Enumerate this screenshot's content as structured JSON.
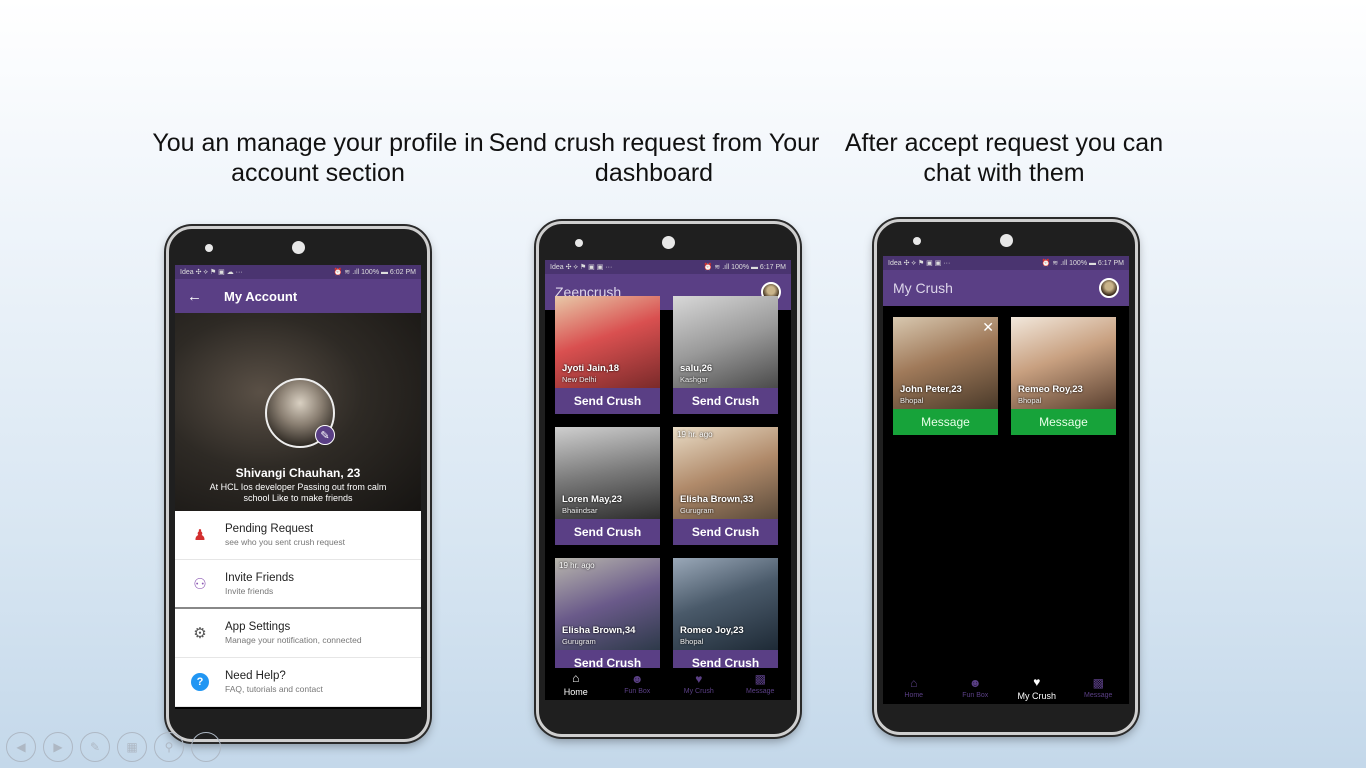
{
  "captions": {
    "left": "You an manage your profile in account section",
    "middle": "Send crush request from Your dashboard",
    "right": "After accept request you can chat with them"
  },
  "phone1": {
    "status_left": "Idea ✣ ⟡ ⚑ ▣ ☁ ···",
    "status_right": "⏰ ≋ .ıll 100% ▬ 6:02 PM",
    "back_icon": "arrow-left-icon",
    "title": "My Account",
    "profile_name": "Shivangi Chauhan, 23",
    "profile_bio": "At HCL Ios developer Passing out from calm school Like to make friends",
    "menu": [
      {
        "title": "Pending Request",
        "subtitle": "see who you sent crush request",
        "icon": "users-icon",
        "color": "#d32f2f"
      },
      {
        "title": "Invite Friends",
        "subtitle": "Invite friends",
        "icon": "add-group-icon",
        "color": "#8e5bb5"
      },
      {
        "title": "App Settings",
        "subtitle": "Manage your notification, connected",
        "icon": "gear-icon",
        "color": "#555555"
      },
      {
        "title": "Need Help?",
        "subtitle": "FAQ, tutorials and contact",
        "icon": "help-icon",
        "color": "#2196f3"
      }
    ]
  },
  "phone2": {
    "status_left": "Idea ✣ ⟡ ⚑ ▣ ▣ ···",
    "status_right": "⏰ ≋ .ıll 100% ▬ 6:17 PM",
    "title": "Zeencrush",
    "cards": [
      {
        "name": "Jyoti Jain,18",
        "location": "New Delhi",
        "time": "",
        "button": "Send Crush",
        "photo": "#c44a4a"
      },
      {
        "name": "salu,26",
        "location": "Kashgar",
        "time": "",
        "button": "Send Crush",
        "photo": "#8a8a8a"
      },
      {
        "name": "Loren May,23",
        "location": "Bhaiindsar",
        "time": "",
        "button": "Send Crush",
        "photo": "#6f6f6f"
      },
      {
        "name": "Elisha Brown,33",
        "location": "Gurugram",
        "time": "19 hr. ago",
        "button": "Send Crush",
        "photo": "#9c8a6e"
      },
      {
        "name": "Elisha Brown,34",
        "location": "Gurugram",
        "time": "19 hr. ago",
        "button": "Send Crush",
        "photo": "#4a6a8a"
      },
      {
        "name": "Romeo Joy,23",
        "location": "Bhopal",
        "time": "",
        "button": "Send Crush",
        "photo": "#3d4a5a"
      }
    ],
    "nav": [
      "Home",
      "Fun Box",
      "My Crush",
      "Message"
    ],
    "active_nav": "Home"
  },
  "phone3": {
    "status_left": "Idea ✣ ⟡ ⚑ ▣ ▣ ···",
    "status_right": "⏰ ≋ .ıll 100% ▬ 6:17 PM",
    "title": "My Crush",
    "cards": [
      {
        "name": "John Peter,23",
        "location": "Bhopal",
        "button": "Message",
        "photo": "#8a6a4e"
      },
      {
        "name": "Remeo Roy,23",
        "location": "Bhopal",
        "button": "Message",
        "photo": "#b98a6a"
      }
    ],
    "nav": [
      "Home",
      "Fun Box",
      "My Crush",
      "Message"
    ],
    "active_nav": "My Crush"
  },
  "toolbar": [
    "prev-icon",
    "next-icon",
    "pen-icon",
    "slides-icon",
    "zoom-icon",
    "more-icon"
  ]
}
